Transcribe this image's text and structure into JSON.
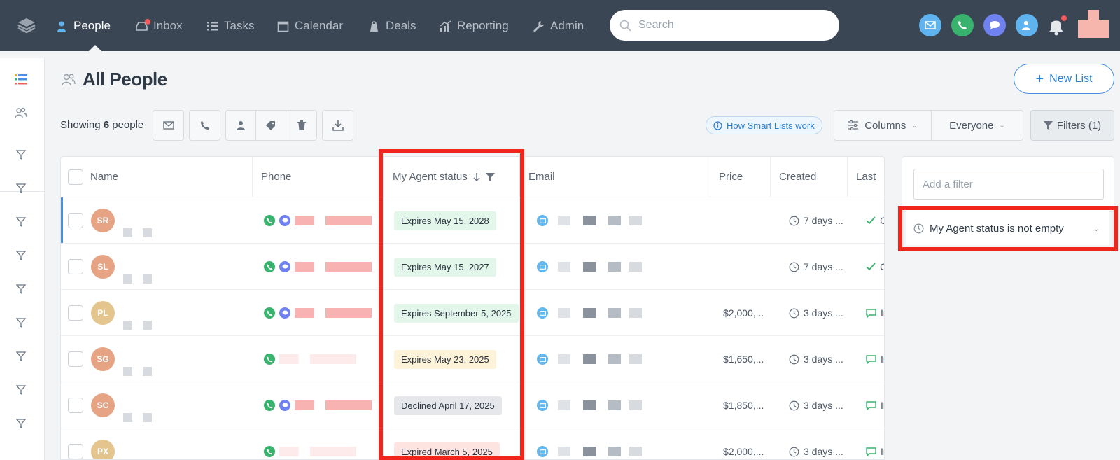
{
  "nav": {
    "items": [
      {
        "label": "People",
        "icon": "person-icon"
      },
      {
        "label": "Inbox",
        "icon": "inbox-icon"
      },
      {
        "label": "Tasks",
        "icon": "tasks-icon"
      },
      {
        "label": "Calendar",
        "icon": "calendar-icon"
      },
      {
        "label": "Deals",
        "icon": "deals-icon"
      },
      {
        "label": "Reporting",
        "icon": "reporting-icon"
      },
      {
        "label": "Admin",
        "icon": "wrench-icon"
      }
    ],
    "search_placeholder": "Search"
  },
  "header": {
    "title": "All People",
    "new_list_label": "New List"
  },
  "toolbar": {
    "showing_prefix": "Showing",
    "count": "6",
    "showing_suffix": "people",
    "smart_lists_link": "How Smart Lists work",
    "columns_label": "Columns",
    "owner_label": "Everyone",
    "filters_label": "Filters (1)"
  },
  "table": {
    "columns": [
      "Name",
      "Phone",
      "My Agent status",
      "Email",
      "Price",
      "Created",
      "Last"
    ],
    "rows": [
      {
        "initials": "SR",
        "avatar_color": "#e6a484",
        "status": "Expires May 15, 2028",
        "status_type": "green",
        "price": "",
        "created": "7 days ...",
        "last": "C",
        "last_icon": "check-icon",
        "purple": true
      },
      {
        "initials": "SL",
        "avatar_color": "#e6a484",
        "status": "Expires May 15, 2027",
        "status_type": "green",
        "price": "",
        "created": "7 days ...",
        "last": "C",
        "last_icon": "check-icon",
        "purple": true
      },
      {
        "initials": "PL",
        "avatar_color": "#e3c58d",
        "status": "Expires September 5, 2025",
        "status_type": "green",
        "price": "$2,000,...",
        "created": "3 days ...",
        "last": "Ir",
        "last_icon": "message-icon",
        "purple": true
      },
      {
        "initials": "SG",
        "avatar_color": "#e6a484",
        "status": "Expires May 23, 2025",
        "status_type": "yellow",
        "price": "$1,650,...",
        "created": "3 days ...",
        "last": "Ir",
        "last_icon": "message-icon",
        "purple": false
      },
      {
        "initials": "SC",
        "avatar_color": "#e6a484",
        "status": "Declined April 17, 2025",
        "status_type": "gray",
        "price": "$1,850,...",
        "created": "3 days ...",
        "last": "Ir",
        "last_icon": "message-icon",
        "purple": true
      },
      {
        "initials": "PX",
        "avatar_color": "#e3c58d",
        "status": "Expired March 5, 2025",
        "status_type": "red",
        "price": "$2,000,...",
        "created": "3 days ...",
        "last": "Ir",
        "last_icon": "message-icon",
        "purple": false
      }
    ]
  },
  "filter_panel": {
    "add_placeholder": "Add a filter",
    "active_filter": "My Agent status is not empty"
  },
  "colors": {
    "nav_bg": "#3a4654",
    "accent": "#2a7fd4",
    "annotation_red": "#f0251b",
    "badge_green": "#e2f6e9",
    "badge_yellow": "#fdf3d9",
    "badge_gray": "#e5e7ea",
    "badge_red": "#fde4e1"
  }
}
